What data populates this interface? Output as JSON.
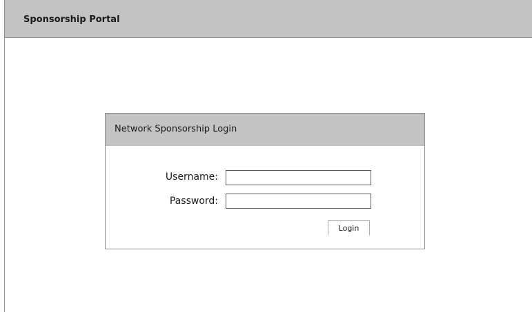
{
  "header": {
    "title": "Sponsorship Portal"
  },
  "login_panel": {
    "title": "Network Sponsorship Login",
    "username_label": "Username:",
    "username_value": "",
    "password_label": "Password:",
    "password_value": "",
    "login_button_label": "Login"
  },
  "colors": {
    "header_background": "#c3c3c3",
    "border": "#8f8f8f",
    "page_background": "#ffffff"
  }
}
